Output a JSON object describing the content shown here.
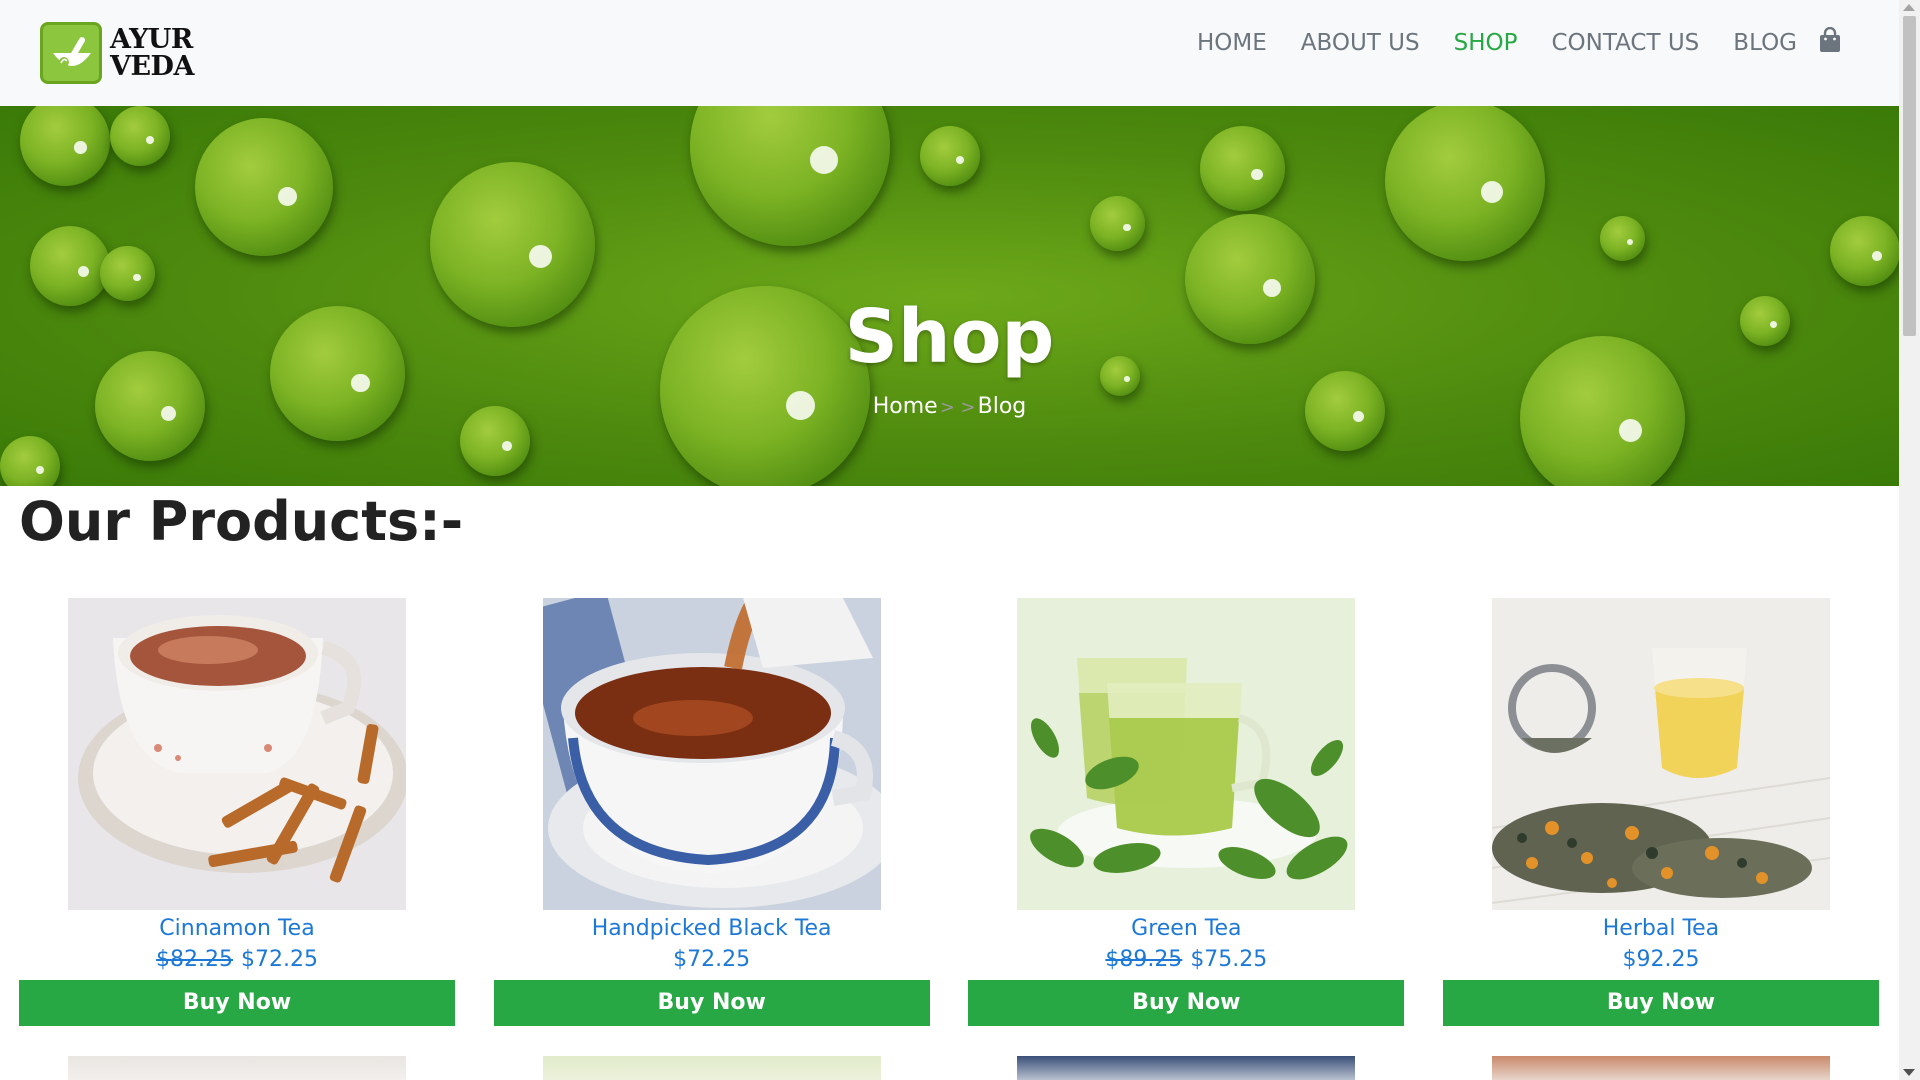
{
  "brand": {
    "logo_text_line1": "AYUR",
    "logo_text_line2": "VEDA"
  },
  "nav": {
    "items": [
      {
        "label": "HOME",
        "active": false
      },
      {
        "label": "ABOUT US",
        "active": false
      },
      {
        "label": "SHOP",
        "active": true
      },
      {
        "label": "CONTACT US",
        "active": false
      },
      {
        "label": "BLOG",
        "active": false
      }
    ],
    "cart_icon": "shopping-bag-icon"
  },
  "hero": {
    "title": "Shop",
    "breadcrumb": {
      "home": "Home",
      "separator": "> >",
      "current": "Blog"
    }
  },
  "products_section": {
    "heading": "Our Products:-",
    "products": [
      {
        "name": "Cinnamon Tea",
        "old_price": "$82.25",
        "price": "$72.25",
        "button": "Buy Now",
        "image": "cinnamon-tea-image"
      },
      {
        "name": "Handpicked Black Tea",
        "old_price": "",
        "price": "$72.25",
        "button": "Buy Now",
        "image": "black-tea-image"
      },
      {
        "name": "Green Tea",
        "old_price": "$89.25",
        "price": "$75.25",
        "button": "Buy Now",
        "image": "green-tea-image"
      },
      {
        "name": "Herbal Tea",
        "old_price": "",
        "price": "$92.25",
        "button": "Buy Now",
        "image": "herbal-tea-image"
      }
    ]
  },
  "colors": {
    "accent": "#28a745",
    "link": "#1e78d6",
    "nav_text": "#6c757d",
    "header_bg": "#f8f9fa"
  }
}
